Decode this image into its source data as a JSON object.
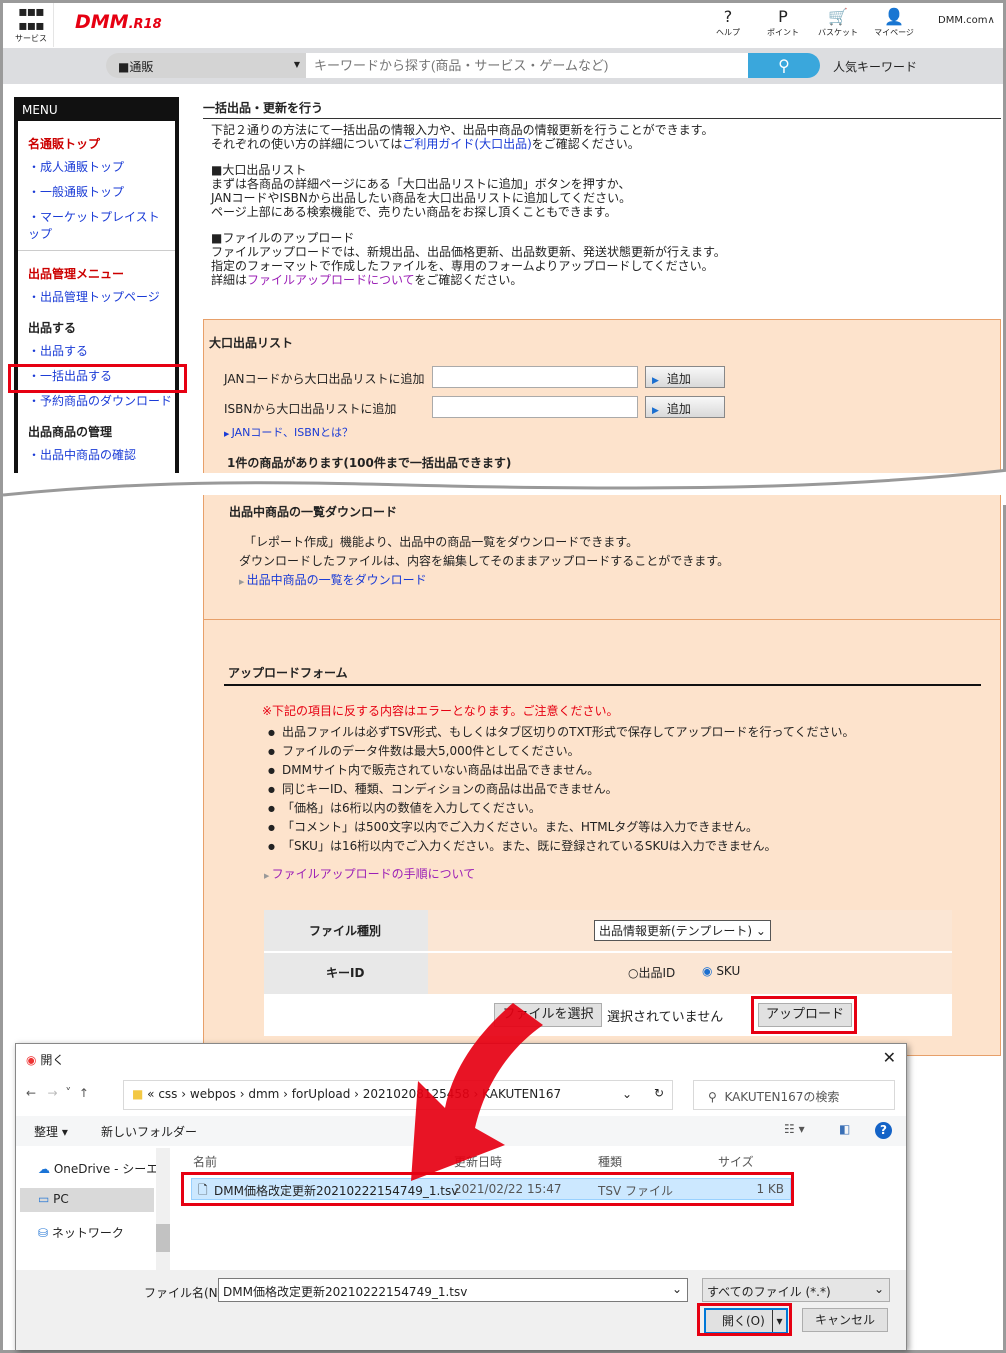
{
  "header": {
    "services": "サービス",
    "logo": "DMM",
    "logo_sub": ".R18",
    "icons": [
      {
        "label": "ヘルプ",
        "glyph": "?"
      },
      {
        "label": "ポイント",
        "glyph": "P"
      },
      {
        "label": "バスケット",
        "glyph": "🛒"
      },
      {
        "label": "マイページ",
        "glyph": "👤"
      }
    ],
    "dmm_com": "DMM.com∧"
  },
  "search": {
    "category": "■通販",
    "placeholder": "キーワードから探す(商品・サービス・ゲームなど)",
    "popular": "人気キーワード"
  },
  "menu": {
    "title": "MENU",
    "top": "名通販トップ",
    "items1": [
      "・成人通販トップ",
      "・一般通販トップ",
      "・マーケットプレイストップ"
    ],
    "mgmt": "出品管理メニュー",
    "mgmt_items": [
      "・出品管理トップページ"
    ],
    "sell": "出品する",
    "sell_items": [
      "・出品する",
      "・一括出品する",
      "・予約商品のダウンロード"
    ],
    "manage": "出品商品の管理",
    "manage_items": [
      "・出品中商品の確認"
    ]
  },
  "intro": {
    "title": "一括出品・更新を行う",
    "l1": "下記２通りの方法にて一括出品の情報入力や、出品中商品の情報更新を行うことができます。",
    "l2a": "それぞれの使い方の詳細については",
    "l2link": "ご利用ガイド(大口出品)",
    "l2b": "をご確認ください。",
    "h1": "■大口出品リスト",
    "h1l1": "まずは各商品の詳細ページにある「大口出品リストに追加」ボタンを押すか、",
    "h1l2": "JANコードやISBNから出品したい商品を大口出品リストに追加してください。",
    "h1l3": "ページ上部にある検索機能で、売りたい商品をお探し頂くこともできます。",
    "h2": "■ファイルのアップロード",
    "h2l1": "ファイルアップロードでは、新規出品、出品価格更新、出品数更新、発送状態更新が行えます。",
    "h2l2": "指定のフォーマットで作成したファイルを、専用のフォームよりアップロードしてください。",
    "h2l3a": "詳細は",
    "h2l3link": "ファイルアップロードについて",
    "h2l3b": "をご確認ください。"
  },
  "bulk": {
    "title": "大口出品リスト",
    "jan_label": "JANコードから大口出品リストに追加",
    "isbn_label": "ISBNから大口出品リストに追加",
    "add": "追加",
    "link": "JANコード、ISBNとは？",
    "count": "1件の商品があります(100件まで一括出品できます)"
  },
  "download": {
    "title": "出品中商品の一覧ダウンロード",
    "l1": "「レポート作成」機能より、出品中の商品一覧をダウンロードできます。",
    "l2": "ダウンロードしたファイルは、内容を編集してそのままアップロードすることができます。",
    "link": "出品中商品の一覧をダウンロード"
  },
  "upload": {
    "title": "アップロードフォーム",
    "warning": "※下記の項目に反する内容はエラーとなります。ご注意ください。",
    "rules": [
      "出品ファイルは必ずTSV形式、もしくはタブ区切りのTXT形式で保存してアップロードを行ってください。",
      "ファイルのデータ件数は最大5,000件としてください。",
      "DMMサイト内で販売されていない商品は出品できません。",
      "同じキーID、種類、コンディションの商品は出品できません。",
      "「価格」は6桁以内の数値を入力してください。",
      "「コメント」は500文字以内でご入力ください。また、HTMLタグ等は入力できません。",
      "「SKU」は16桁以内でご入力ください。また、既に登録されているSKUは入力できません。"
    ],
    "link": "ファイルアップロードの手順について",
    "file_type_label": "ファイル種別",
    "file_type_value": "出品情報更新(テンプレート)",
    "key_label": "キーID",
    "key_opt1": "出品ID",
    "key_opt2": "SKU",
    "choose": "ファイルを選択",
    "no_file": "選択されていません",
    "upload_btn": "アップロード"
  },
  "dialog": {
    "title": "開く",
    "path": [
      "css",
      "webpos",
      "dmm",
      "forUpload",
      "20210208125458",
      "KAKUTEN167"
    ],
    "search_placeholder": "KAKUTEN167の検索",
    "organize": "整理 ▾",
    "new_folder": "新しいフォルダー",
    "nav": [
      "OneDrive - シーエス",
      "PC",
      "ネットワーク"
    ],
    "cols": [
      "名前",
      "更新日時",
      "種類",
      "サイズ"
    ],
    "file": {
      "name": "DMM価格改定更新20210222154749_1.tsv",
      "date": "2021/02/22 15:47",
      "type": "TSV ファイル",
      "size": "1 KB"
    },
    "filename_label": "ファイル名(N):",
    "filename": "DMM価格改定更新20210222154749_1.tsv",
    "filter": "すべてのファイル (*.*)",
    "open": "開く(O)",
    "cancel": "キャンセル"
  },
  "colors": {
    "accent_red": "#e60012",
    "orange_bg": "#fde3cc",
    "search_blue": "#3aa7dc"
  }
}
